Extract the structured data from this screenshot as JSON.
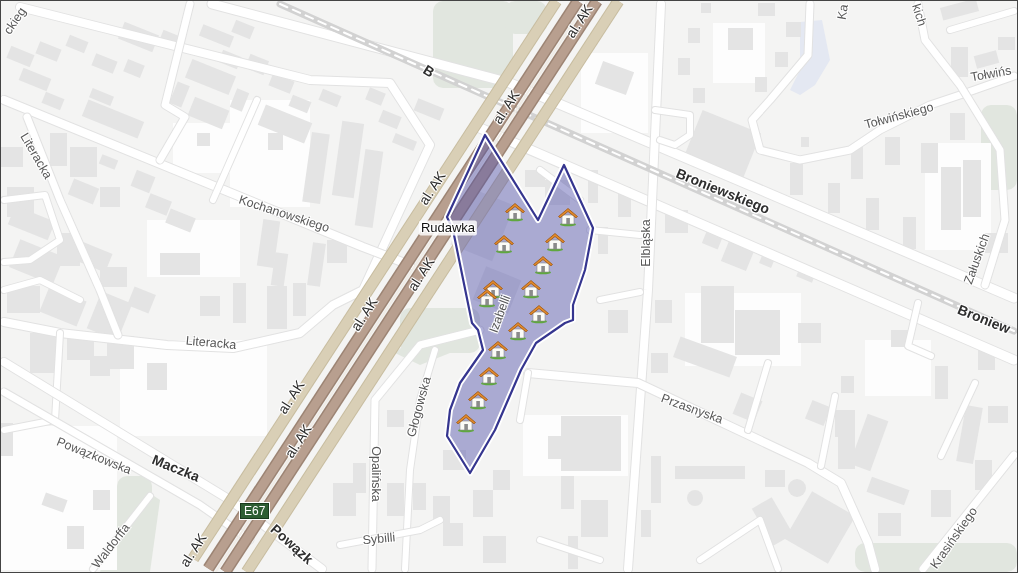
{
  "map": {
    "labels": [
      {
        "text": "ckieg",
        "kind": "street"
      },
      {
        "text": "B",
        "kind": "major"
      },
      {
        "text": "al. AK",
        "kind": "highway"
      },
      {
        "text": "al. AK",
        "kind": "highway"
      },
      {
        "text": "al. AK",
        "kind": "highway"
      },
      {
        "text": "al. AK",
        "kind": "highway"
      },
      {
        "text": "al. AK",
        "kind": "highway"
      },
      {
        "text": "al. AK",
        "kind": "highway"
      },
      {
        "text": "al. AK",
        "kind": "highway"
      },
      {
        "text": "al. AK",
        "kind": "highway"
      },
      {
        "text": "Literacka",
        "kind": "street"
      },
      {
        "text": "Kochanowskiego",
        "kind": "street"
      },
      {
        "text": "Rudawka",
        "kind": "place"
      },
      {
        "text": "Ka",
        "kind": "street"
      },
      {
        "text": "kich",
        "kind": "street"
      },
      {
        "text": "Tołwińs",
        "kind": "street"
      },
      {
        "text": "Tołwińskiego",
        "kind": "street"
      },
      {
        "text": "Broniewskiego",
        "kind": "major"
      },
      {
        "text": "Elbląska",
        "kind": "street"
      },
      {
        "text": "Załuskich",
        "kind": "street"
      },
      {
        "text": "Broniew",
        "kind": "major"
      },
      {
        "text": "Izabelli",
        "kind": "street"
      },
      {
        "text": "Literacka",
        "kind": "street"
      },
      {
        "text": "Głogowska",
        "kind": "street"
      },
      {
        "text": "Opalińska",
        "kind": "street"
      },
      {
        "text": "Sybilli",
        "kind": "street"
      },
      {
        "text": "Przasnyska",
        "kind": "street"
      },
      {
        "text": "Powązkowska",
        "kind": "street"
      },
      {
        "text": "Maczka",
        "kind": "major"
      },
      {
        "text": "Powązk",
        "kind": "major"
      },
      {
        "text": "Waldorffa",
        "kind": "street"
      },
      {
        "text": "Krasińskiego",
        "kind": "street"
      }
    ],
    "road_badge": {
      "text": "E67"
    },
    "area": {
      "markers": [
        {
          "kind": "house"
        },
        {
          "kind": "house"
        },
        {
          "kind": "house"
        },
        {
          "kind": "house"
        },
        {
          "kind": "house"
        },
        {
          "kind": "house"
        },
        {
          "kind": "house"
        },
        {
          "kind": "house"
        },
        {
          "kind": "house"
        },
        {
          "kind": "house"
        },
        {
          "kind": "house"
        },
        {
          "kind": "house"
        },
        {
          "kind": "house"
        },
        {
          "kind": "house"
        }
      ]
    }
  }
}
